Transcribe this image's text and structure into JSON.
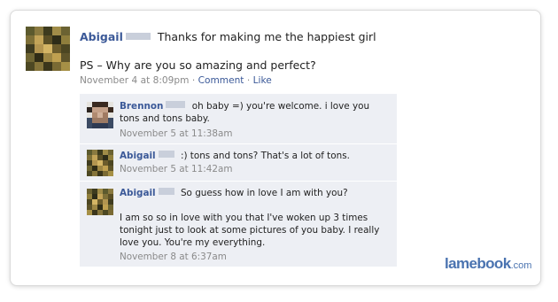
{
  "post": {
    "author": "Abigail",
    "message": "Thanks for making me the happiest girl",
    "ps": "PS – Why are you so amazing and perfect?",
    "timestamp": "November 4 at 8:09pm",
    "separator": "·",
    "comment_label": "Comment",
    "like_label": "Like"
  },
  "comments": [
    {
      "author": "Brennon",
      "text_line1": "oh baby =) you're welcome. i love you",
      "text_line2": "tons and tons baby.",
      "timestamp": "November 5 at 11:38am"
    },
    {
      "author": "Abigail",
      "text_line1": ":) tons and tons? That's a lot of tons.",
      "timestamp": "November 5 at 11:42am"
    },
    {
      "author": "Abigail",
      "text_line1": "So guess how in love I am with you?",
      "body_line1": "I am so so in love with you that I've woken up 3 times",
      "body_line2": "tonight just to look at some pictures of you baby. I really",
      "body_line3": "love you. You're my everything.",
      "timestamp": "November 8 at 6:37am"
    }
  ],
  "watermark": {
    "brand": "lamebook",
    "suffix": ".com"
  },
  "colors": {
    "link": "#3b5998",
    "reply_bg": "#edeff4",
    "meta": "#8a8a8a",
    "watermark": "#4a73b0"
  }
}
